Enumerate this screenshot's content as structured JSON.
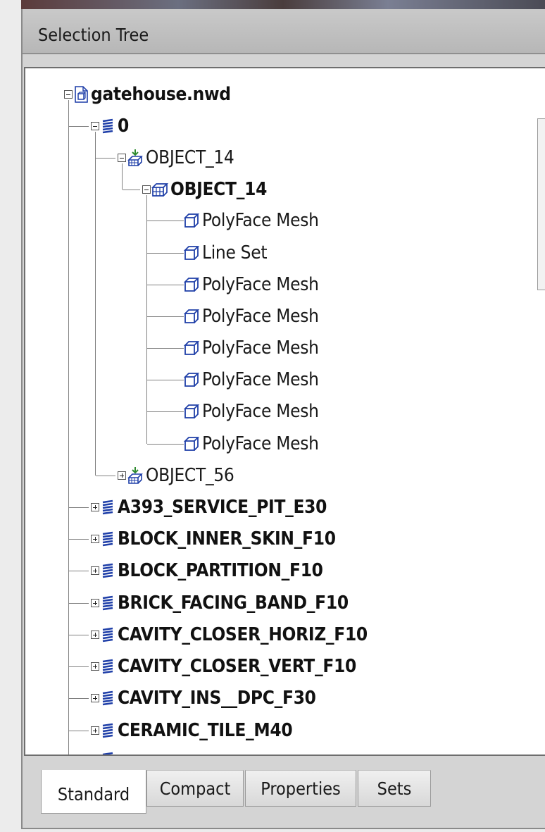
{
  "window": {
    "title": "Selection Tree"
  },
  "tree": {
    "root": {
      "label": "gatehouse.nwd",
      "icon": "file-icon"
    },
    "layer0": {
      "label": "0",
      "icon": "layer-icon"
    },
    "object14_group": {
      "label": "OBJECT_14",
      "icon": "insert-icon"
    },
    "object14": {
      "label": "OBJECT_14",
      "icon": "group-icon"
    },
    "geometry": [
      "PolyFace Mesh",
      "Line Set",
      "PolyFace Mesh",
      "PolyFace Mesh",
      "PolyFace Mesh",
      "PolyFace Mesh",
      "PolyFace Mesh",
      "PolyFace Mesh"
    ],
    "object56": {
      "label": "OBJECT_56",
      "icon": "insert-icon"
    },
    "layers": [
      "A393_SERVICE_PIT_E30",
      "BLOCK_INNER_SKIN_F10",
      "BLOCK_PARTITION_F10",
      "BRICK_FACING_BAND_F10",
      "CAVITY_CLOSER_HORIZ_F10",
      "CAVITY_CLOSER_VERT_F10",
      "CAVITY_INS__DPC_F30",
      "CERAMIC_TILE_M40"
    ]
  },
  "tabs": [
    {
      "label": "Standard",
      "active": true
    },
    {
      "label": "Compact",
      "active": false
    },
    {
      "label": "Properties",
      "active": false
    },
    {
      "label": "Sets",
      "active": false
    }
  ],
  "colors": {
    "icon_blue": "#1f3fa8",
    "icon_green": "#2e8b2e",
    "selected_text": "#111111"
  }
}
